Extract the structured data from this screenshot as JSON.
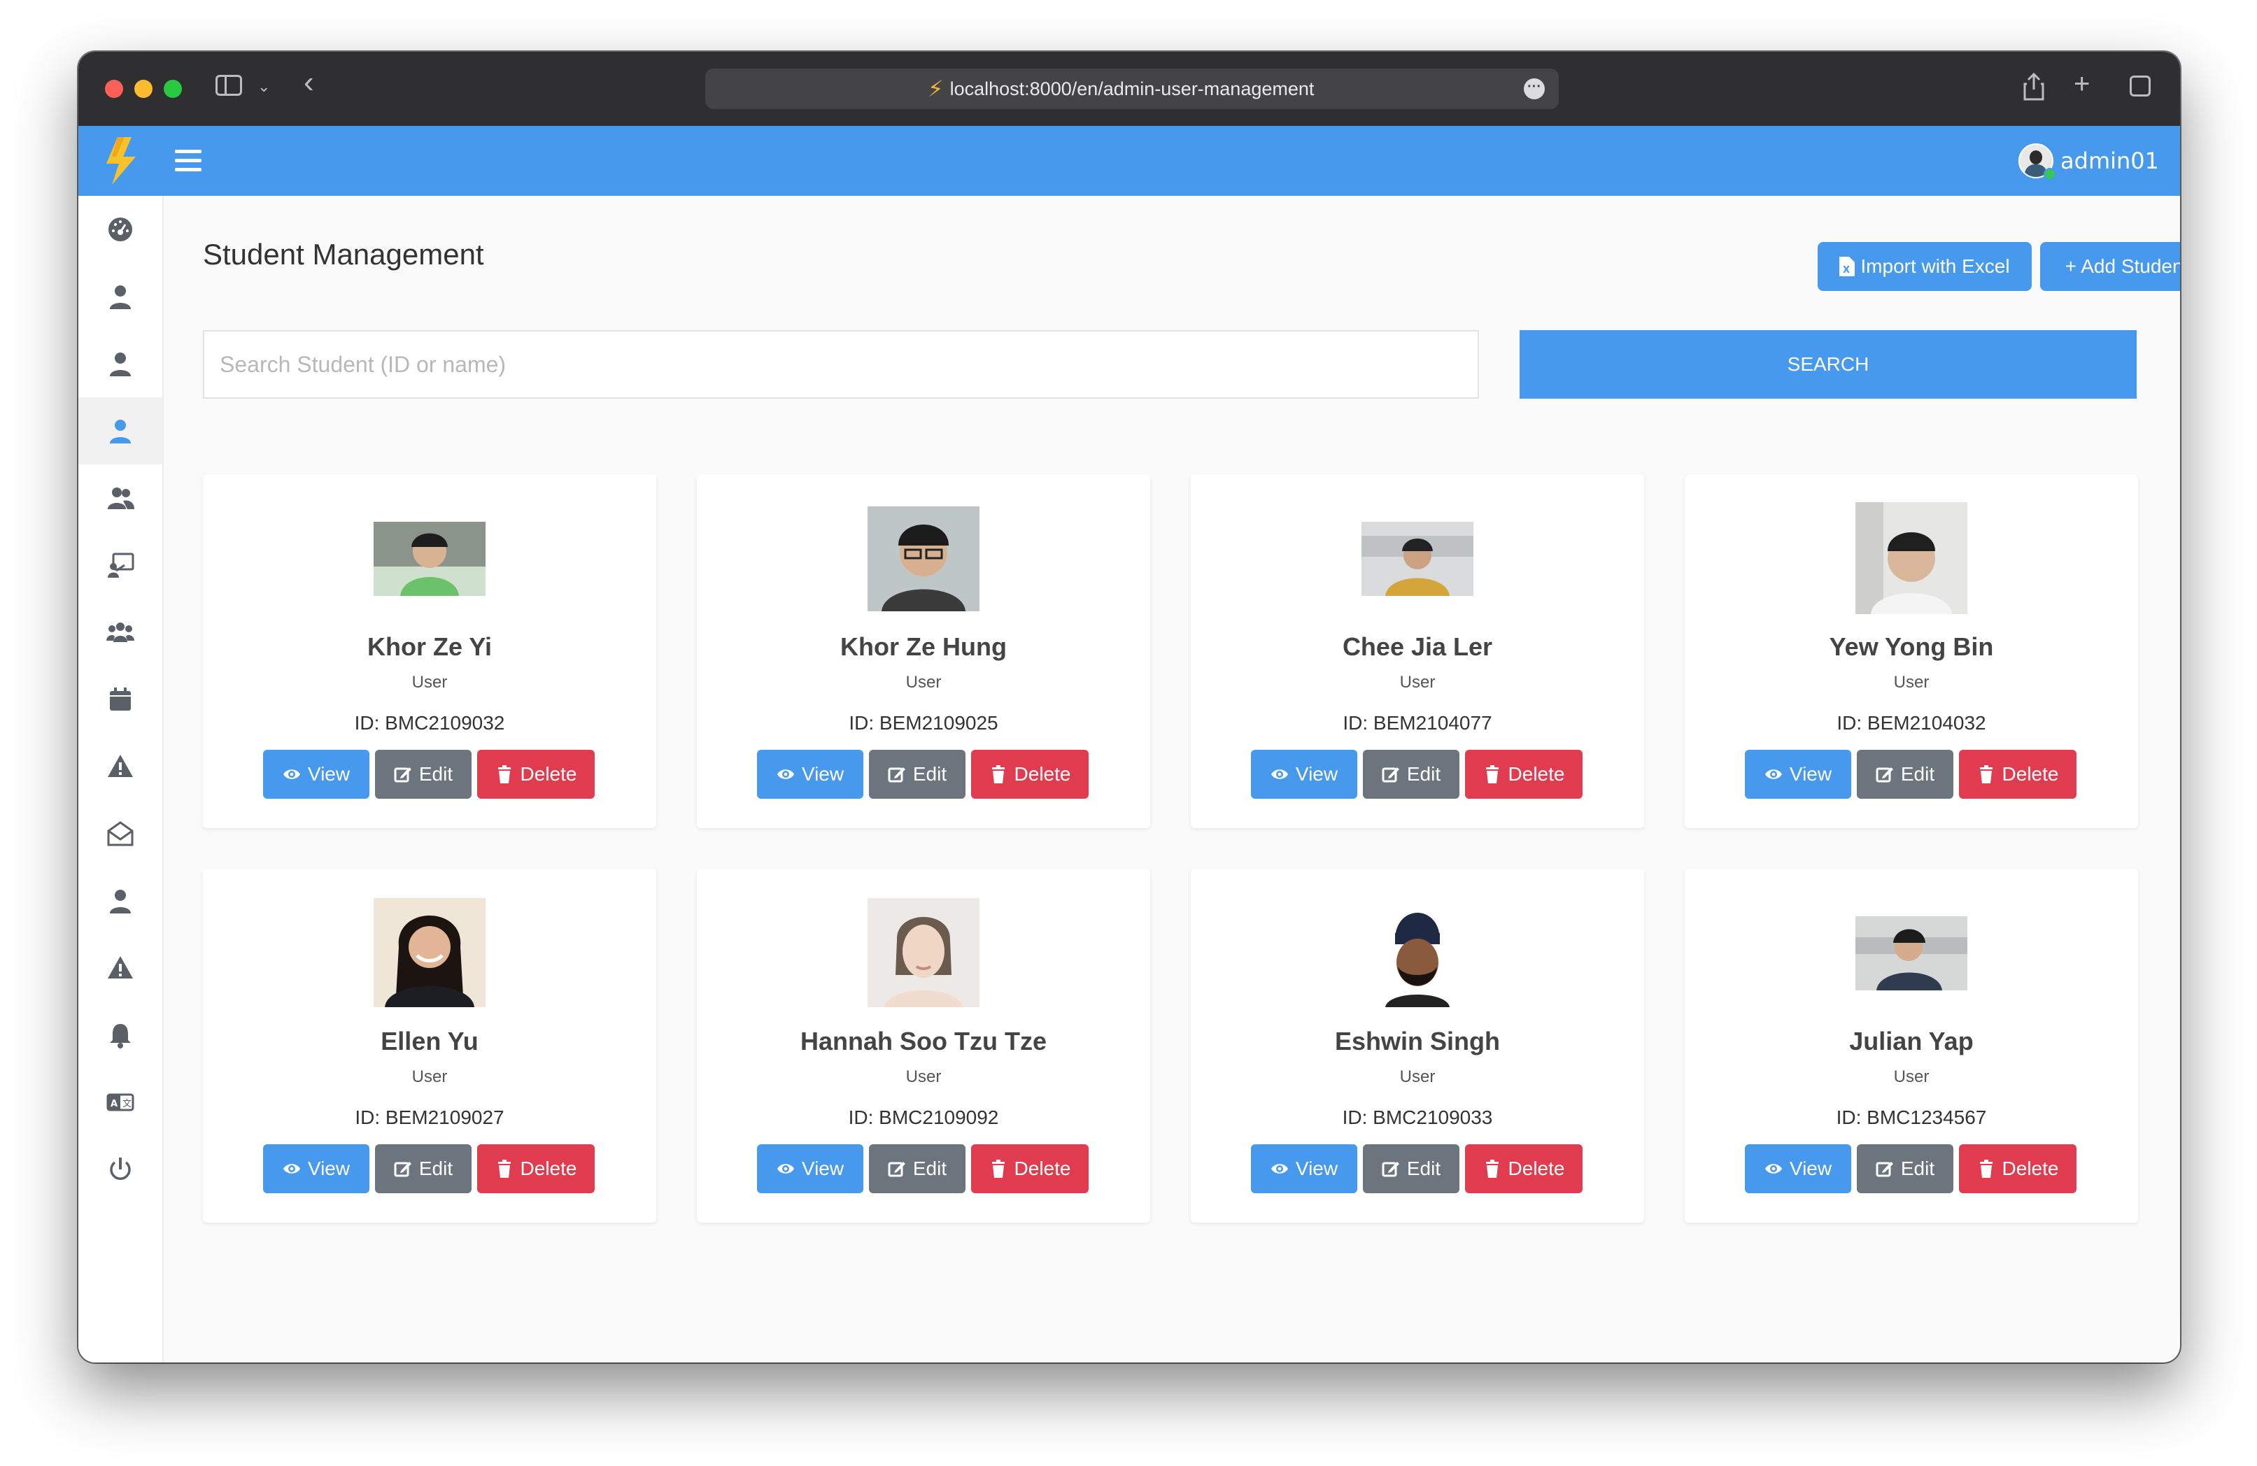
{
  "browser": {
    "url": "localhost:8000/en/admin-user-management"
  },
  "header": {
    "username": "admin01"
  },
  "sidebar_icons": [
    "dashboard-icon",
    "user-icon",
    "user-icon",
    "user-icon-active",
    "users-icon",
    "chalkboard-teacher-icon",
    "users-group-icon",
    "calendar-icon",
    "warning-icon",
    "envelope-open-icon",
    "user-icon",
    "warning-icon",
    "bell-icon",
    "language-icon",
    "power-icon"
  ],
  "page": {
    "title": "Student Management",
    "import_label": "Import with Excel",
    "add_label": "+ Add Student",
    "search_placeholder": "Search Student (ID or name)",
    "search_label": "SEARCH"
  },
  "actions": {
    "view": "View",
    "edit": "Edit",
    "delete": "Delete"
  },
  "students": [
    {
      "name": "Khor Ze Yi",
      "role": "User",
      "id": "ID: BMC2109032"
    },
    {
      "name": "Khor Ze Hung",
      "role": "User",
      "id": "ID: BEM2109025"
    },
    {
      "name": "Chee Jia Ler",
      "role": "User",
      "id": "ID: BEM2104077"
    },
    {
      "name": "Yew Yong Bin",
      "role": "User",
      "id": "ID: BEM2104032"
    },
    {
      "name": "Ellen Yu",
      "role": "User",
      "id": "ID: BEM2109027"
    },
    {
      "name": "Hannah Soo Tzu Tze",
      "role": "User",
      "id": "ID: BMC2109092"
    },
    {
      "name": "Eshwin Singh",
      "role": "User",
      "id": "ID: BMC2109033"
    },
    {
      "name": "Julian Yap",
      "role": "User",
      "id": "ID: BMC1234567"
    }
  ],
  "colors": {
    "primary": "#4699ed",
    "secondary": "#6c757d",
    "danger": "#e03b4e"
  }
}
